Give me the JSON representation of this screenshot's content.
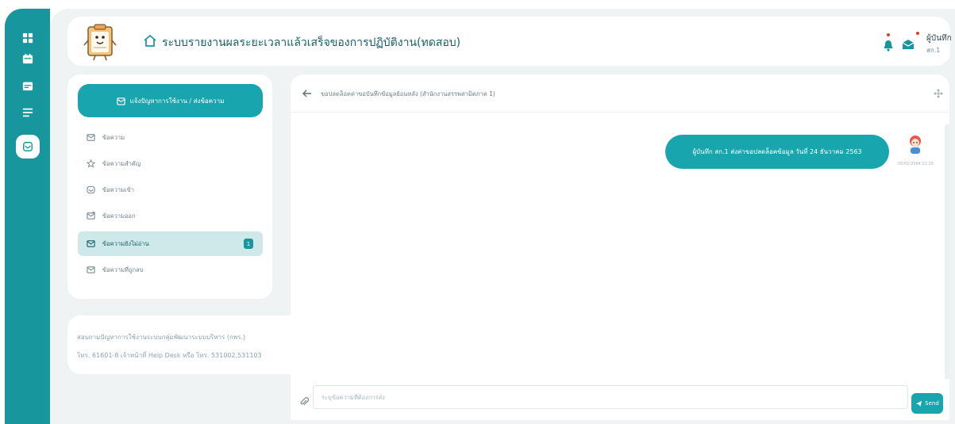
{
  "app": {
    "title": "ระบบรายงานผลระยะเวลาแล้วเสร็จของการปฏิบัติงาน(ทดสอบ)",
    "user_name": "ผู้บันทึก",
    "user_role": "สก.1"
  },
  "rail": {
    "items": [
      {
        "icon": "dashboard-icon"
      },
      {
        "icon": "calendar-icon"
      },
      {
        "icon": "calendar-check-icon"
      },
      {
        "icon": "list-icon"
      },
      {
        "icon": "mail-open-icon",
        "active": true
      }
    ]
  },
  "sidebar": {
    "compose_label": "แจ้งปัญหาการใช้งาน / ส่งข้อความ",
    "items": [
      {
        "label": "ข้อความ",
        "icon": "mail-icon"
      },
      {
        "label": "ข้อความสำคัญ",
        "icon": "star-icon"
      },
      {
        "label": "ข้อความเข้า",
        "icon": "inbox-icon"
      },
      {
        "label": "ข้อความออก",
        "icon": "outbox-icon"
      },
      {
        "label": "ข้อความยังไม่อ่าน",
        "icon": "unread-mail-icon",
        "badge": "1",
        "active": true
      },
      {
        "label": "ข้อความที่ถูกลบ",
        "icon": "deleted-mail-icon"
      }
    ]
  },
  "help": {
    "line1": "สอบถามปัญหาการใช้งานระบบกลุ่มพัฒนาระบบบริหาร (กพร.)",
    "line2": "โทร. 61601-8 เจ้าหน้าที่ Help Desk หรือ โทร. 531002,531103"
  },
  "chat": {
    "title": "ขอปลดล็อคค่าขอบันทึกข้อมูลย้อนหลัง (สำนักงานสรรพสามิตภาค 1)",
    "messages": [
      {
        "text": "ผู้บันทึก สก.1 ส่งค่าขอปลดล็อคข้อมูล วันที่ 24 ธันวาคม 2563",
        "time": "05/01/2564 11:20"
      }
    ],
    "input_placeholder": "ระบุข้อความที่ต้องการส่ง",
    "send_label": "Send"
  },
  "colors": {
    "primary": "#19a5ad",
    "rail": "#17969e",
    "background": "#eff3f4",
    "badge": "#17969e",
    "notification_dot": "#e53935"
  }
}
